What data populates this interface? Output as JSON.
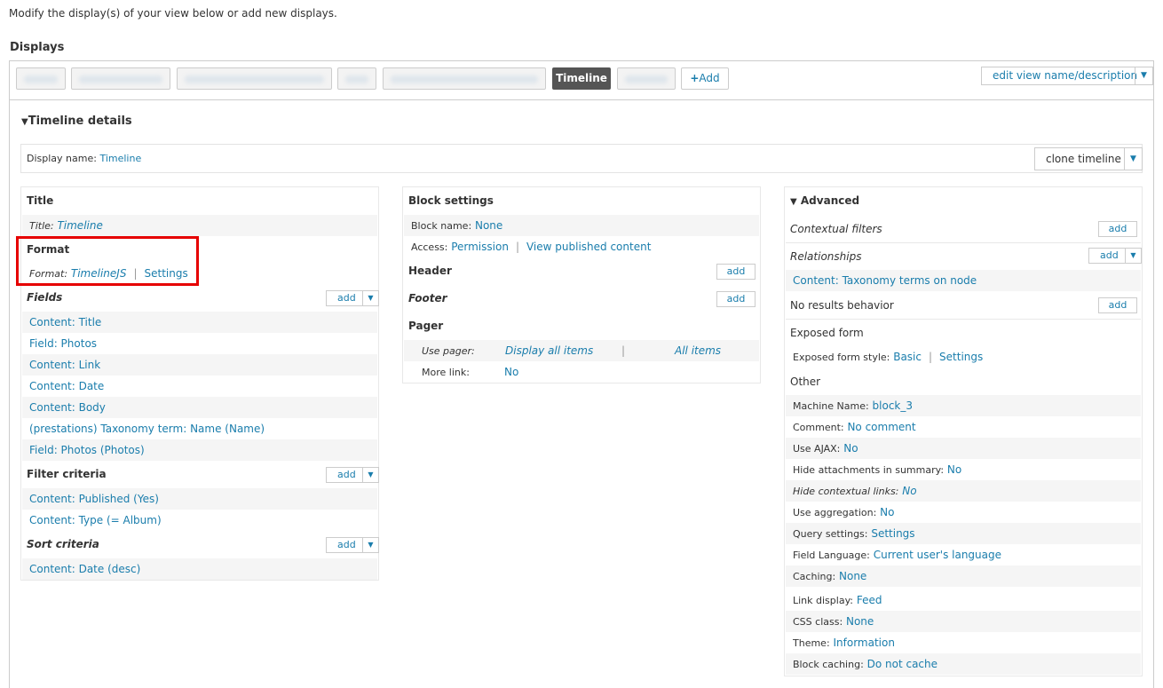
{
  "intro": "Modify the display(s) of your view below or add new displays.",
  "displays_heading": "Displays",
  "tabs": {
    "active": "Timeline",
    "add": "Add",
    "add_plus": "+"
  },
  "edit_view": "edit view name/description",
  "details": {
    "heading": "Timeline details",
    "display_name_label": "Display name:",
    "display_name_value": "Timeline",
    "clone": "clone timeline"
  },
  "left": {
    "title_heading": "Title",
    "title_label": "Title:",
    "title_value": "Timeline",
    "format_heading": "Format",
    "format_label": "Format:",
    "format_value": "TimelineJS",
    "format_settings": "Settings",
    "fields_heading": "Fields",
    "fields": [
      "Content: Title",
      "Field: Photos",
      "Content: Link",
      "Content: Date",
      "Content: Body",
      "(prestations) Taxonomy term: Name (Name)",
      "Field: Photos (Photos)"
    ],
    "filter_heading": "Filter criteria",
    "filters": [
      "Content: Published (Yes)",
      "Content: Type (= Album)"
    ],
    "sort_heading": "Sort criteria",
    "sorts": [
      "Content: Date (desc)"
    ],
    "add": "add"
  },
  "middle": {
    "block_heading": "Block settings",
    "block_name_label": "Block name:",
    "block_name_value": "None",
    "access_label": "Access:",
    "access_value": "Permission",
    "access_perm": "View published content",
    "header_heading": "Header",
    "footer_heading": "Footer",
    "pager_heading": "Pager",
    "use_pager_label": "Use pager:",
    "use_pager_value": "Display all items",
    "use_pager_items": "All items",
    "more_link_label": "More link:",
    "more_link_value": "No",
    "add": "add"
  },
  "right": {
    "advanced": "Advanced",
    "contextual": "Contextual filters",
    "relationships": "Relationships",
    "relationship_item": "Content: Taxonomy terms on node",
    "no_results": "No results behavior",
    "exposed_heading": "Exposed form",
    "exposed_style_label": "Exposed form style:",
    "exposed_style_value": "Basic",
    "exposed_settings": "Settings",
    "other_heading": "Other",
    "add": "add",
    "other": [
      {
        "k": "Machine Name:",
        "v": "block_3"
      },
      {
        "k": "Comment:",
        "v": "No comment"
      },
      {
        "k": "Use AJAX:",
        "v": "No"
      },
      {
        "k": "Hide attachments in summary:",
        "v": "No"
      },
      {
        "k": "Hide contextual links:",
        "v": "No"
      },
      {
        "k": "Use aggregation:",
        "v": "No"
      },
      {
        "k": "Query settings:",
        "v": "Settings"
      },
      {
        "k": "Field Language:",
        "v": "Current user's language"
      },
      {
        "k": "Caching:",
        "v": "None"
      },
      {
        "k": "Link display:",
        "v": "Feed"
      },
      {
        "k": "CSS class:",
        "v": "None"
      },
      {
        "k": "Theme:",
        "v": "Information"
      },
      {
        "k": "Block caching:",
        "v": "Do not cache"
      }
    ]
  }
}
